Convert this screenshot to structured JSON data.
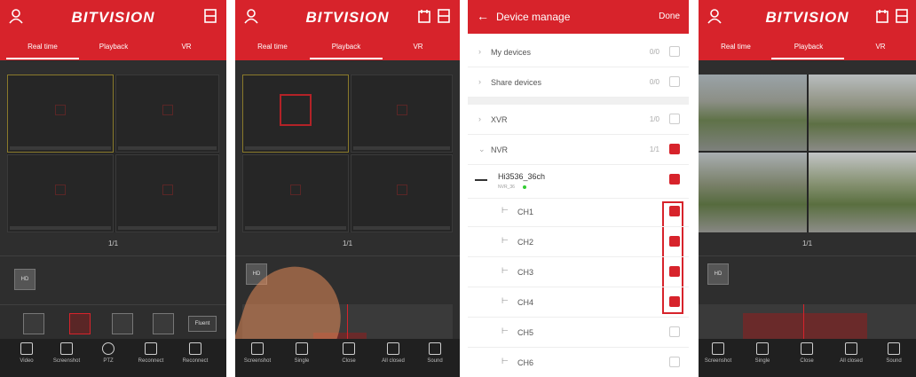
{
  "app": {
    "logo": "BITVISION"
  },
  "tabs": {
    "realtime": "Real time",
    "playback": "Playback",
    "vr": "VR"
  },
  "live": {
    "page": "1/1",
    "badge": "HD",
    "fluent": "Fluent",
    "nav": [
      {
        "label": "Video",
        "icon": "video-icon"
      },
      {
        "label": "Screenshot",
        "icon": "screenshot-icon"
      },
      {
        "label": "PTZ",
        "icon": "ptz-icon"
      },
      {
        "label": "Reconnect",
        "icon": "reconnect-icon"
      },
      {
        "label": "Reconnect",
        "icon": "reconnect-all-icon"
      }
    ]
  },
  "playback_nav": [
    {
      "label": "Screenshot",
      "icon": "screenshot-icon"
    },
    {
      "label": "Single",
      "icon": "single-icon"
    },
    {
      "label": "Close",
      "icon": "close-icon"
    },
    {
      "label": "All closed",
      "icon": "all-closed-icon"
    },
    {
      "label": "Sound",
      "icon": "sound-icon"
    }
  ],
  "device": {
    "title": "Device manage",
    "done": "Done",
    "rows": [
      {
        "label": "My devices",
        "count": "0/0",
        "checked": false
      },
      {
        "label": "Share devices",
        "count": "0/0",
        "checked": false
      },
      {
        "label": "XVR",
        "count": "1/0",
        "checked": false
      },
      {
        "label": "NVR",
        "count": "1/1",
        "checked": true
      }
    ],
    "device_name": "Hi3536_36ch",
    "device_sub": "NVR_36",
    "channels": [
      {
        "label": "CH1",
        "checked": true
      },
      {
        "label": "CH2",
        "checked": true
      },
      {
        "label": "CH3",
        "checked": true
      },
      {
        "label": "CH4",
        "checked": true
      },
      {
        "label": "CH5",
        "checked": false
      },
      {
        "label": "CH6",
        "checked": false
      }
    ]
  },
  "accent": "#d7232b"
}
